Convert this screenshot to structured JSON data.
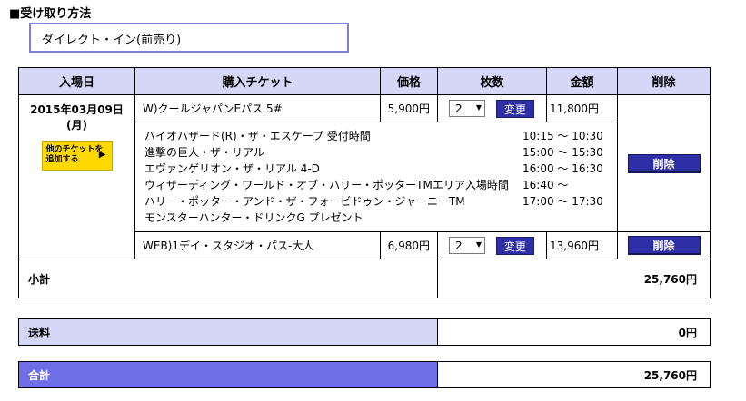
{
  "receive": {
    "title": "■受け取り方法",
    "value": "ダイレクト・イン(前売り)"
  },
  "cart": {
    "headers": [
      "入場日",
      "購入チケット",
      "価格",
      "枚数",
      "金額",
      "削除"
    ],
    "date": "2015年03月09日",
    "weekday": "(月)",
    "add_ticket_line1": "他のチケットを",
    "add_ticket_line2": "追加する",
    "add_ticket_arrow": "▶",
    "change_label": "変更",
    "delete_label": "削除",
    "items": [
      {
        "name": "W)クールジャパンEパス 5#",
        "price": "5,900円",
        "qty": "2",
        "total": "11,800円"
      },
      {
        "name": "WEB)1デイ・スタジオ・パス-大人",
        "price": "6,980円",
        "qty": "2",
        "total": "13,960円"
      }
    ],
    "details": [
      {
        "name": "バイオハザード(R)・ザ・エスケープ 受付時間",
        "time": "10:15 ～ 10:30"
      },
      {
        "name": "進撃の巨人・ザ・リアル",
        "time": "15:00 ～ 15:30"
      },
      {
        "name": "エヴァンゲリオン・ザ・リアル 4-D",
        "time": "16:00 ～ 16:30"
      },
      {
        "name": "ウィザーディング・ワールド・オブ・ハリー・ポッターTMエリア入場時間",
        "time": "16:40 ～"
      },
      {
        "name": "ハリー・ポッター・アンド・ザ・フォービドゥン・ジャーニーTM",
        "time": "17:00 ～ 17:30"
      },
      {
        "name": "モンスターハンター・ドリンクG プレゼント",
        "time": ""
      }
    ],
    "subtotal_label": "小計",
    "subtotal_value": "25,760円"
  },
  "shipping": {
    "label": "送料",
    "value": "0円"
  },
  "grand_total": {
    "label": "合計",
    "value": "25,760円"
  },
  "colors": {
    "header_bg": "#d6d6f6",
    "button_bg": "#2e2ea6",
    "grand_total_bg": "#6e6ee6",
    "add_ticket_bg": "#ffd800",
    "receive_border": "#7f7fd6"
  }
}
